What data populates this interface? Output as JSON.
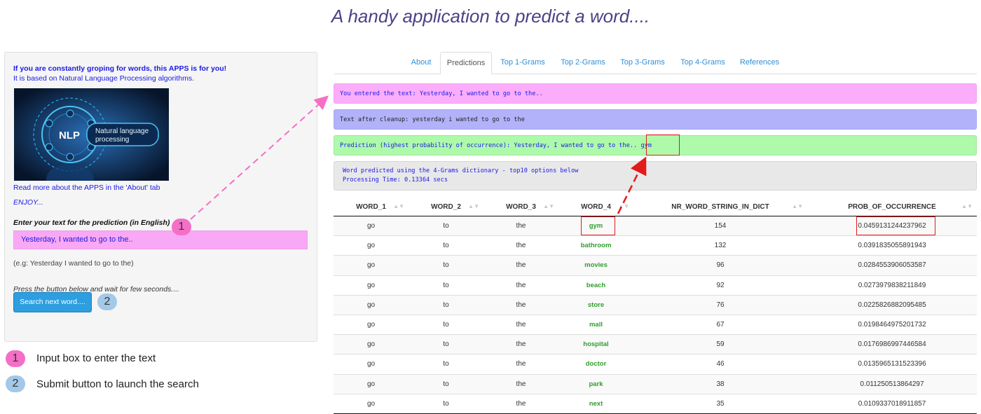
{
  "app_title": "A handy application to predict a word....",
  "sidebar": {
    "intro_bold": "If you are constantly groping for words, this APPS is for you!",
    "intro_text": "It is based on Natural Language Processing algorithms.",
    "image": {
      "caption_main": "NLP",
      "caption_line1": "Natural language",
      "caption_line2": "processing"
    },
    "read_more": "Read more about the APPS in the 'About' tab",
    "enjoy": "ENJOY...",
    "input_label": "Enter your text for the prediction (in English)",
    "input_value": "Yesterday, I wanted to go to the..",
    "example": "(e.g: Yesterday I wanted to go to the)",
    "press_text": "Press the button below and wait for few seconds....",
    "search_button": "Search next word...."
  },
  "badges": {
    "one": "1",
    "two": "2"
  },
  "legend": {
    "item1": "Input box to enter the text",
    "item2": "Submit button to launch the search"
  },
  "tabs": [
    "About",
    "Predictions",
    "Top 1-Grams",
    "Top 2-Grams",
    "Top 3-Grams",
    "Top 4-Grams",
    "References"
  ],
  "active_tab": "Predictions",
  "messages": {
    "entered": "You entered the text:  Yesterday, I wanted to go to the..",
    "cleanup": "Text after cleanup:  yesterday i wanted to go to the",
    "prediction_prefix": "Prediction (highest probability of occurrence):  Yesterday, I wanted to go to the..",
    "prediction_word": "gym",
    "info_line1": "Word predicted using the 4-Grams dictionary - top10 options below",
    "info_line2": "Processing Time: 0.13364 secs"
  },
  "table": {
    "columns": [
      "WORD_1",
      "WORD_2",
      "WORD_3",
      "WORD_4",
      "NR_WORD_STRING_IN_DICT",
      "PROB_OF_OCCURRENCE"
    ],
    "rows": [
      [
        "go",
        "to",
        "the",
        "gym",
        "154",
        "0.0459131244237962"
      ],
      [
        "go",
        "to",
        "the",
        "bathroom",
        "132",
        "0.0391835055891943"
      ],
      [
        "go",
        "to",
        "the",
        "movies",
        "96",
        "0.0284553906053587"
      ],
      [
        "go",
        "to",
        "the",
        "beach",
        "92",
        "0.0273979838211849"
      ],
      [
        "go",
        "to",
        "the",
        "store",
        "76",
        "0.0225826882095485"
      ],
      [
        "go",
        "to",
        "the",
        "mall",
        "67",
        "0.0198464975201732"
      ],
      [
        "go",
        "to",
        "the",
        "hospital",
        "59",
        "0.0176986997446584"
      ],
      [
        "go",
        "to",
        "the",
        "doctor",
        "46",
        "0.0135965131523396"
      ],
      [
        "go",
        "to",
        "the",
        "park",
        "38",
        "0.011250513864297"
      ],
      [
        "go",
        "to",
        "the",
        "next",
        "35",
        "0.0109337018911857"
      ]
    ]
  },
  "colors": {
    "title": "#4f3f86",
    "link_blue": "#1a1ae6",
    "input_pink": "#f9a8f5",
    "button_blue": "#2d9ee0",
    "msg_pink": "#fbadfb",
    "msg_lavender": "#b2b2fb",
    "msg_green": "#aefaaa",
    "word_green": "#2e9e2e",
    "highlight_red": "#e21b1b",
    "badge_pink": "#f56fc6",
    "badge_blue": "#a3c8e8"
  }
}
